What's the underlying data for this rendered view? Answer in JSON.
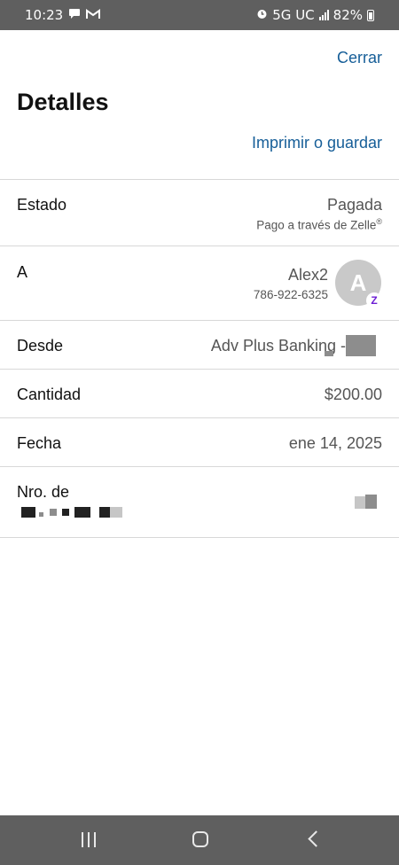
{
  "status_bar": {
    "time": "10:23",
    "network": "5G UC",
    "battery": "82%",
    "left_icons": [
      "chat-icon",
      "gmail-icon"
    ],
    "right_icons": [
      "alarm-icon",
      "signal-icon",
      "battery-icon"
    ]
  },
  "header": {
    "close_label": "Cerrar",
    "title": "Detalles",
    "print_label": "Imprimir o guardar"
  },
  "details": {
    "status": {
      "label": "Estado",
      "value": "Pagada",
      "sub": "Pago a través de Zelle",
      "sub_mark": "®"
    },
    "to": {
      "label": "A",
      "name": "Alex2",
      "phone": "786-922-6325",
      "avatar_initial": "A",
      "badge": "Z"
    },
    "from": {
      "label": "Desde",
      "value": "Adv Plus Banking -"
    },
    "amount": {
      "label": "Cantidad",
      "value": "$200.00"
    },
    "date": {
      "label": "Fecha",
      "value": "ene 14, 2025"
    },
    "reference": {
      "label": "Nro. de"
    }
  },
  "colors": {
    "link": "#165e98",
    "status_bar": "#5f5f5f",
    "zelle_purple": "#6d1ed4"
  },
  "nav_bar": {
    "icons": [
      "recent-apps-icon",
      "home-icon",
      "back-icon"
    ]
  }
}
